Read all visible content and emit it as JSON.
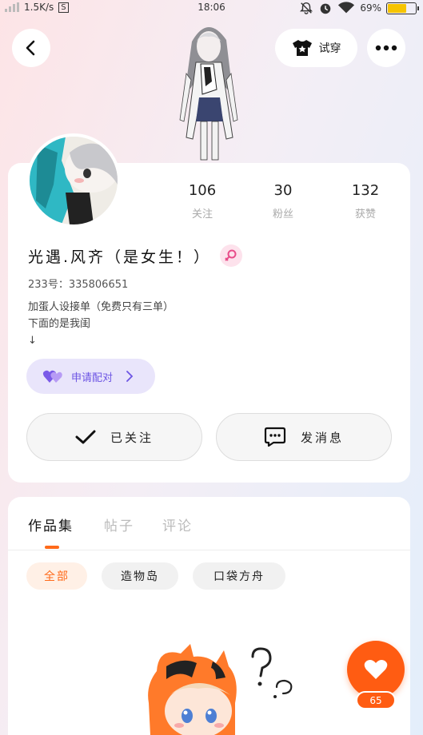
{
  "status_bar": {
    "speed": "1.5K/s",
    "s_badge": "S",
    "time": "18:06",
    "battery": "69%",
    "battery_level": 0.69
  },
  "header": {
    "try_on_label": "试穿"
  },
  "profile": {
    "stats": [
      {
        "value": "106",
        "label": "关注"
      },
      {
        "value": "30",
        "label": "粉丝"
      },
      {
        "value": "132",
        "label": "获赞"
      }
    ],
    "nickname": "光遇.风齐（是女生！）",
    "uid": "233号：335806651",
    "bio_lines": [
      "加蛋人设接单（免费只有三单）",
      "下面的是我闺",
      "↓"
    ],
    "pair_label": "申请配对",
    "follow_label": "已关注",
    "message_label": "发消息"
  },
  "tabs": [
    "作品集",
    "帖子",
    "评论"
  ],
  "filters": [
    "全部",
    "造物岛",
    "口袋方舟"
  ],
  "like": {
    "count": "65"
  },
  "colors": {
    "accent": "#ff5c12",
    "pair_bg": "#e9e5fb",
    "pair_text": "#6d55e4",
    "gender_icon": "#e84d8a",
    "battery_fill": "#f6c400"
  }
}
